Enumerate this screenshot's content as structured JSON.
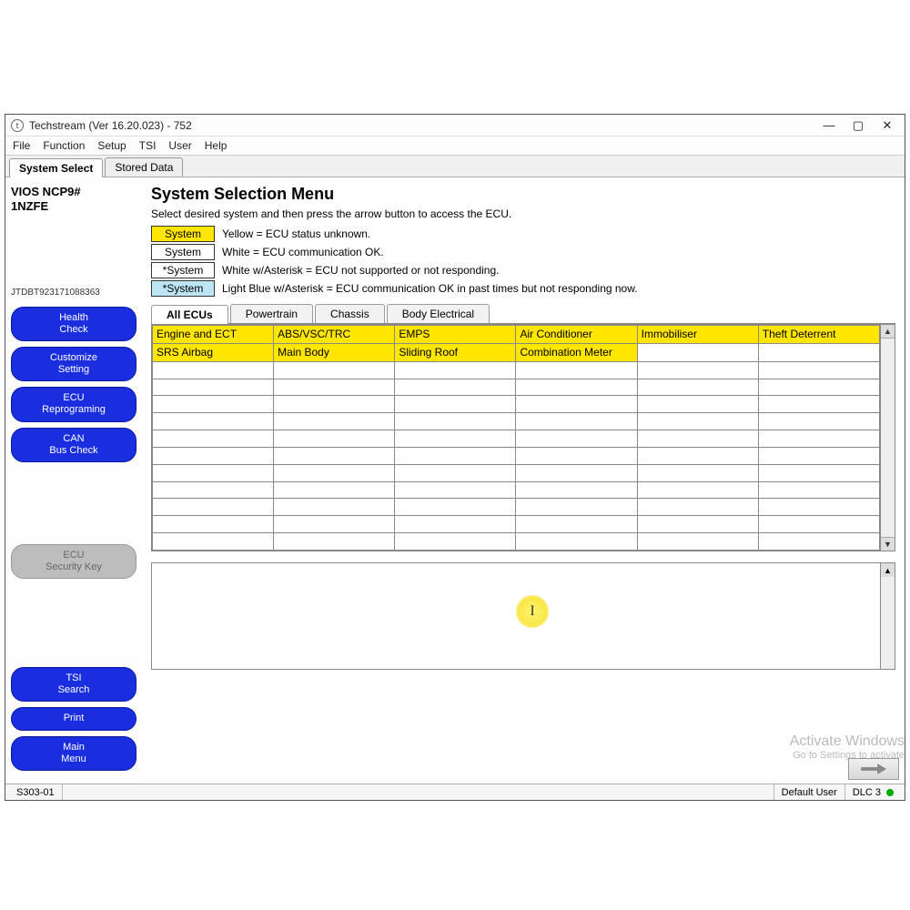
{
  "window": {
    "title": "Techstream (Ver 16.20.023) - 752"
  },
  "menubar": [
    "File",
    "Function",
    "Setup",
    "TSI",
    "User",
    "Help"
  ],
  "top_tabs": {
    "active": "System Select",
    "items": [
      "System Select",
      "Stored Data"
    ]
  },
  "sidebar": {
    "vehicle_line1": "VIOS NCP9#",
    "vehicle_line2": "1NZFE",
    "vin": "JTDBT923171088363",
    "buttons_top": [
      {
        "label": "Health Check",
        "disabled": false
      },
      {
        "label": "Customize Setting",
        "disabled": false
      },
      {
        "label": "ECU Reprograming",
        "disabled": false
      },
      {
        "label": "CAN Bus Check",
        "disabled": false
      },
      {
        "label": "ECU Security Key",
        "disabled": true
      }
    ],
    "buttons_bottom": [
      {
        "label": "TSI Search"
      },
      {
        "label": "Print"
      },
      {
        "label": "Main Menu"
      }
    ]
  },
  "main": {
    "title": "System Selection Menu",
    "subtitle": "Select desired system and then press the arrow button to access the ECU.",
    "legend": [
      {
        "chip": "System",
        "cls": "chip-yellow",
        "text": "Yellow = ECU status unknown."
      },
      {
        "chip": "System",
        "cls": "chip-white",
        "text": "White = ECU communication OK."
      },
      {
        "chip": "*System",
        "cls": "chip-white",
        "text": "White w/Asterisk = ECU not supported or not responding."
      },
      {
        "chip": "*System",
        "cls": "chip-lightblue",
        "text": "Light Blue w/Asterisk = ECU communication OK in past times but not responding now."
      }
    ],
    "ecu_tabs": {
      "active": "All ECUs",
      "items": [
        "All ECUs",
        "Powertrain",
        "Chassis",
        "Body Electrical"
      ]
    },
    "grid_cols": 6,
    "grid_data": [
      [
        "Engine and ECT",
        "ABS/VSC/TRC",
        "EMPS",
        "Air Conditioner",
        "Immobiliser",
        "Theft Deterrent"
      ],
      [
        "SRS Airbag",
        "Main Body",
        "Sliding Roof",
        "Combination Meter",
        "",
        ""
      ]
    ],
    "grid_yellow_pattern": [
      [
        true,
        true,
        true,
        true,
        true,
        true
      ],
      [
        true,
        true,
        true,
        true,
        false,
        false
      ]
    ],
    "grid_empty_rows": 11
  },
  "watermark": {
    "line1": "Activate Windows",
    "line2": "Go to Settings to activate"
  },
  "statusbar": {
    "left": "S303-01",
    "user": "Default User",
    "right": "DLC 3"
  }
}
